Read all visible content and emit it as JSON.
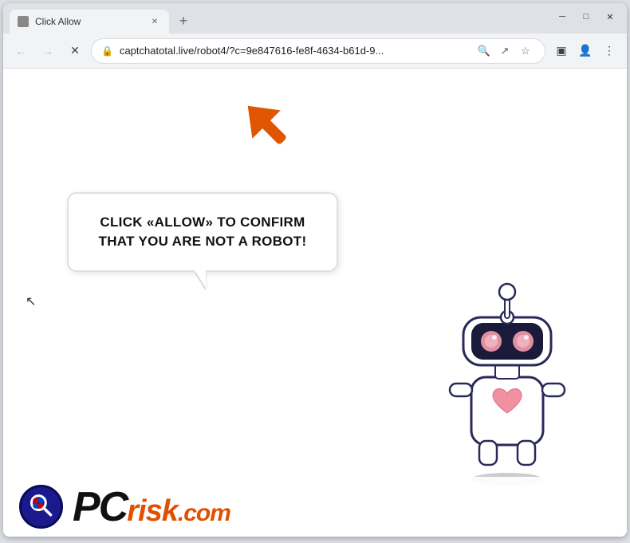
{
  "browser": {
    "title": "Click Allow",
    "url": "captchatotal.live/robot4/?c=9e847616-fe8f-4634-b61d-9...",
    "url_full": "captchatotal.live/robot4/?c=9e847616-fe8f-4634-b61d-9...",
    "new_tab_label": "+",
    "window_controls": {
      "minimize": "─",
      "maximize": "□",
      "close": "✕"
    },
    "nav": {
      "back": "←",
      "forward": "→",
      "reload": "✕"
    }
  },
  "page": {
    "bubble_text": "CLICK «ALLOW» TO CONFIRM THAT YOU ARE NOT A ROBOT!",
    "arrow_color": "#e05000"
  },
  "watermark": {
    "brand": "PC",
    "risk": "risk",
    "tld": ".com"
  }
}
